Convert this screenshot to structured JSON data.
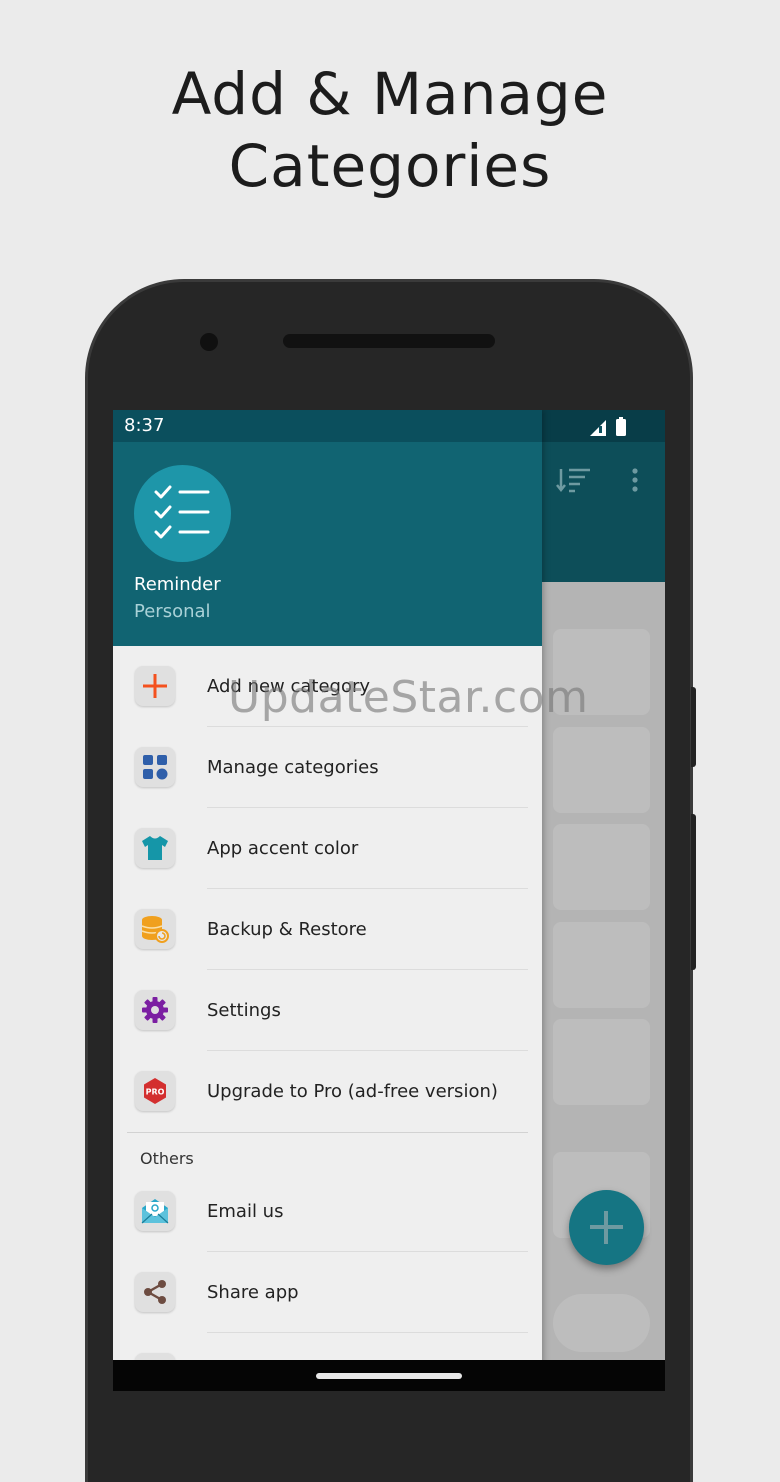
{
  "headline": {
    "line1": "Add & Manage",
    "line2": "Categories"
  },
  "status_bar": {
    "time": "8:37",
    "icons": [
      "signal-icon",
      "battery-icon"
    ]
  },
  "toolbar": {
    "icons": [
      "sort-icon",
      "more-vert-icon"
    ]
  },
  "drawer": {
    "header": {
      "title": "Reminder",
      "subtitle": "Personal",
      "logo_icon": "checklist-icon"
    },
    "items": [
      {
        "label": "Add new category",
        "icon": "plus-icon",
        "color": "#f4511e"
      },
      {
        "label": "Manage categories",
        "icon": "grid-icon",
        "color": "#2f5faa"
      },
      {
        "label": "App accent color",
        "icon": "tshirt-icon",
        "color": "#1596a8"
      },
      {
        "label": "Backup & Restore",
        "icon": "database-restore-icon",
        "color": "#f0a01e"
      },
      {
        "label": "Settings",
        "icon": "gear-icon",
        "color": "#7b1fa2"
      },
      {
        "label": "Upgrade to Pro (ad-free version)",
        "icon": "pro-badge-icon",
        "icon_text": "PRO",
        "color": "#d32f2f"
      }
    ],
    "others_title": "Others",
    "others": [
      {
        "label": "Email us",
        "icon": "email-icon",
        "color": "#29a7c9"
      },
      {
        "label": "Share app",
        "icon": "share-icon",
        "color": "#6d4c41"
      }
    ]
  },
  "fab": {
    "icon": "plus-icon"
  },
  "watermark": "UpdateStar.com"
}
